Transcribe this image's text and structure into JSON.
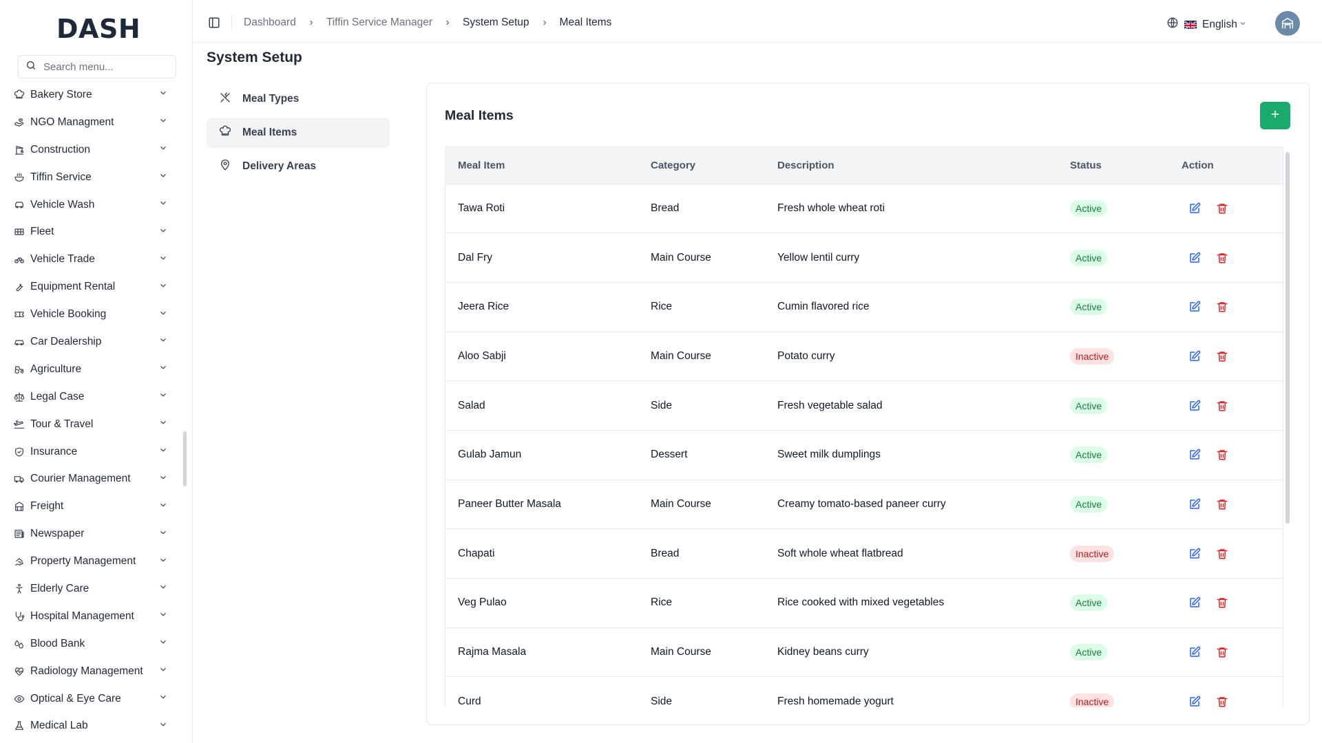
{
  "brand": {
    "logo_text": "DASH"
  },
  "search": {
    "placeholder": "Search menu..."
  },
  "sidebar": {
    "items": [
      {
        "label": "Bakery Store",
        "icon": "chef-hat-icon"
      },
      {
        "label": "NGO Managment",
        "icon": "hand-heart-icon"
      },
      {
        "label": "Construction",
        "icon": "crane-icon"
      },
      {
        "label": "Tiffin Service",
        "icon": "bowl-icon"
      },
      {
        "label": "Vehicle Wash",
        "icon": "car-icon"
      },
      {
        "label": "Fleet",
        "icon": "truck-icon"
      },
      {
        "label": "Vehicle Trade",
        "icon": "bike-icon"
      },
      {
        "label": "Equipment Rental",
        "icon": "wrench-icon"
      },
      {
        "label": "Vehicle Booking",
        "icon": "ticket-icon"
      },
      {
        "label": "Car Dealership",
        "icon": "car-front-icon"
      },
      {
        "label": "Agriculture",
        "icon": "tractor-icon"
      },
      {
        "label": "Legal Case",
        "icon": "scale-icon"
      },
      {
        "label": "Tour & Travel",
        "icon": "plane-icon"
      },
      {
        "label": "Insurance",
        "icon": "shield-icon"
      },
      {
        "label": "Courier Management",
        "icon": "package-truck-icon"
      },
      {
        "label": "Freight",
        "icon": "container-icon"
      },
      {
        "label": "Newspaper",
        "icon": "newspaper-icon"
      },
      {
        "label": "Property Management",
        "icon": "house-hand-icon"
      },
      {
        "label": "Elderly Care",
        "icon": "accessibility-icon"
      },
      {
        "label": "Hospital Management",
        "icon": "stethoscope-icon"
      },
      {
        "label": "Blood Bank",
        "icon": "droplets-icon"
      },
      {
        "label": "Radiology Management",
        "icon": "heart-pulse-icon"
      },
      {
        "label": "Optical & Eye Care",
        "icon": "eye-icon"
      },
      {
        "label": "Medical Lab",
        "icon": "flask-icon"
      }
    ]
  },
  "header": {
    "breadcrumbs": [
      "Dashboard",
      "Tiffin Service Manager",
      "System Setup",
      "Meal Items"
    ],
    "language": "English"
  },
  "page": {
    "title": "System Setup",
    "nav": [
      {
        "label": "Meal Types",
        "icon": "utensils-crossed-icon",
        "active": false
      },
      {
        "label": "Meal Items",
        "icon": "chef-hat-icon",
        "active": true
      },
      {
        "label": "Delivery Areas",
        "icon": "map-pin-icon",
        "active": false
      }
    ]
  },
  "card": {
    "title": "Meal Items",
    "columns": [
      "Meal Item",
      "Category",
      "Description",
      "Status",
      "Action"
    ],
    "rows": [
      {
        "name": "Tawa Roti",
        "category": "Bread",
        "description": "Fresh whole wheat roti",
        "status": "Active"
      },
      {
        "name": "Dal Fry",
        "category": "Main Course",
        "description": "Yellow lentil curry",
        "status": "Active"
      },
      {
        "name": "Jeera Rice",
        "category": "Rice",
        "description": "Cumin flavored rice",
        "status": "Active"
      },
      {
        "name": "Aloo Sabji",
        "category": "Main Course",
        "description": "Potato curry",
        "status": "Inactive"
      },
      {
        "name": "Salad",
        "category": "Side",
        "description": "Fresh vegetable salad",
        "status": "Active"
      },
      {
        "name": "Gulab Jamun",
        "category": "Dessert",
        "description": "Sweet milk dumplings",
        "status": "Active"
      },
      {
        "name": "Paneer Butter Masala",
        "category": "Main Course",
        "description": "Creamy tomato-based paneer curry",
        "status": "Active"
      },
      {
        "name": "Chapati",
        "category": "Bread",
        "description": "Soft whole wheat flatbread",
        "status": "Inactive"
      },
      {
        "name": "Veg Pulao",
        "category": "Rice",
        "description": "Rice cooked with mixed vegetables",
        "status": "Active"
      },
      {
        "name": "Rajma Masala",
        "category": "Main Course",
        "description": "Kidney beans curry",
        "status": "Active"
      },
      {
        "name": "Curd",
        "category": "Side",
        "description": "Fresh homemade yogurt",
        "status": "Inactive"
      }
    ]
  },
  "colors": {
    "accent": "#1aab6c",
    "active_bg": "#dcfce7",
    "active_text": "#15803d",
    "inactive_bg": "#fee2e2",
    "inactive_text": "#b91c1c",
    "edit": "#2563eb",
    "delete": "#dc2626"
  }
}
